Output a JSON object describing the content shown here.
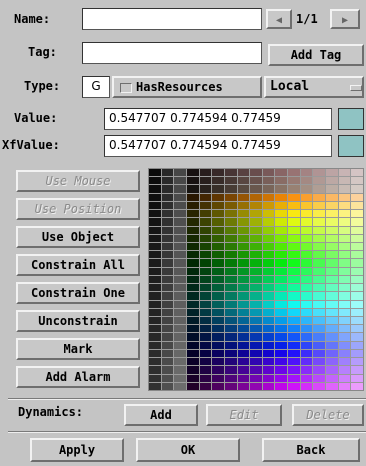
{
  "labels": {
    "name": "Name:",
    "tag": "Tag:",
    "type": "Type:",
    "value": "Value:",
    "xfvalue": "XfValue:",
    "dynamics": "Dynamics:"
  },
  "name_field": {
    "value": ""
  },
  "tag_field": {
    "value": ""
  },
  "pager": {
    "prev_icon": "◀",
    "text": "1/1",
    "next_icon": "▶"
  },
  "add_tag_label": "Add Tag",
  "type_row": {
    "g_field": "G",
    "has_resources_label": "HasResources",
    "scope_value": "Local"
  },
  "value_field": {
    "value": "0.547707 0.774594 0.77459"
  },
  "xfvalue_field": {
    "value": "0.547707 0.774594 0.77459"
  },
  "swatch_color": "#8fc3c3",
  "side_buttons": [
    {
      "label": "Use Mouse",
      "enabled": false
    },
    {
      "label": "Use Position",
      "enabled": false
    },
    {
      "label": "Use Object",
      "enabled": true
    },
    {
      "label": "Constrain All",
      "enabled": true
    },
    {
      "label": "Constrain One",
      "enabled": true
    },
    {
      "label": "Unconstrain",
      "enabled": true
    },
    {
      "label": "Mark",
      "enabled": true
    },
    {
      "label": "Add Alarm",
      "enabled": true
    }
  ],
  "dynamics_buttons": {
    "add": "Add",
    "edit": "Edit",
    "delete": "Delete"
  },
  "bottom_buttons": {
    "apply": "Apply",
    "ok": "OK",
    "back": "Back"
  }
}
